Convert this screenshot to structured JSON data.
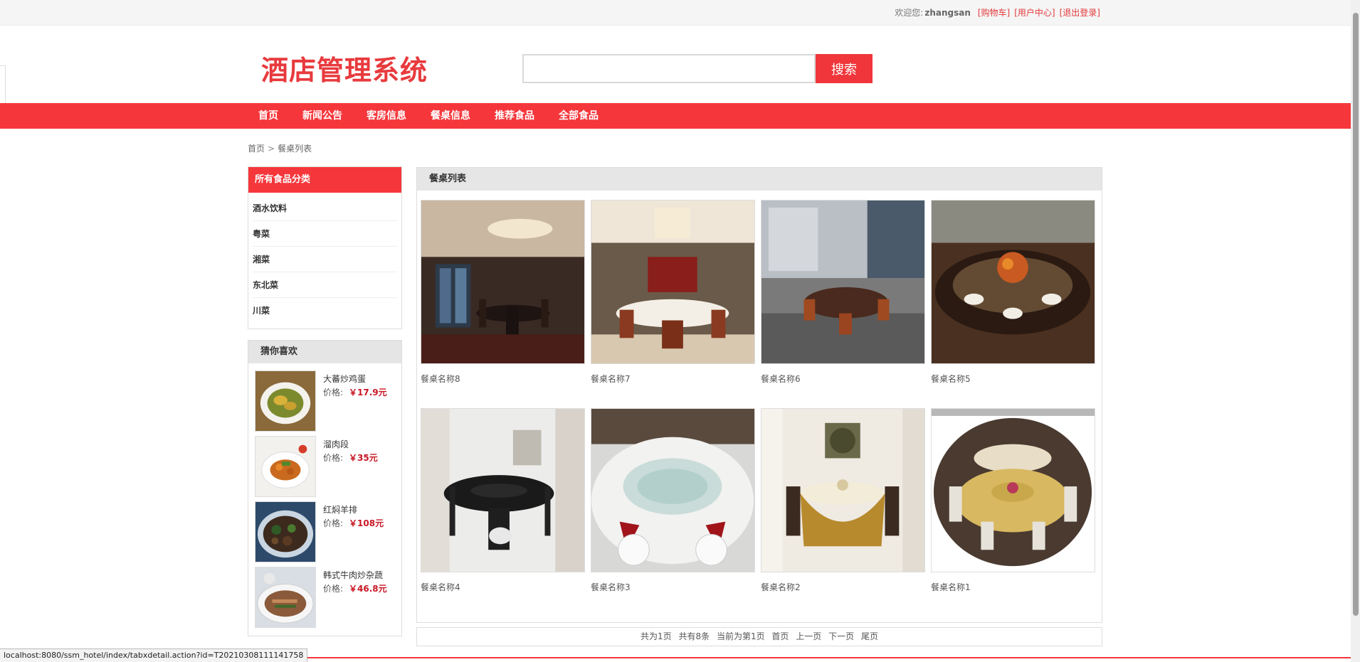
{
  "topbar": {
    "welcome": "欢迎您:",
    "username": "zhangsan",
    "links": [
      "[购物车]",
      "[用户中心]",
      "[退出登录]"
    ]
  },
  "header": {
    "logo": "酒店管理系统",
    "search_placeholder": "",
    "search_button": "搜索"
  },
  "nav": [
    "首页",
    "新闻公告",
    "客房信息",
    "餐桌信息",
    "推荐食品",
    "全部食品"
  ],
  "breadcrumb": {
    "home": "首页",
    "separator": ">",
    "current": "餐桌列表"
  },
  "categories": {
    "title": "所有食品分类",
    "items": [
      "酒水饮料",
      "粤菜",
      "湘菜",
      "东北菜",
      "川菜"
    ]
  },
  "recommend": {
    "title": "猜你喜欢",
    "price_label": "价格:",
    "items": [
      {
        "name": "大蕃炒鸡蛋",
        "price": "￥17.9元"
      },
      {
        "name": "溜肉段",
        "price": "￥35元"
      },
      {
        "name": "红焖羊排",
        "price": "￥108元"
      },
      {
        "name": "韩式牛肉炒杂蔬",
        "price": "￥46.8元"
      }
    ]
  },
  "main": {
    "title": "餐桌列表",
    "tables": [
      {
        "name": "餐桌名称8"
      },
      {
        "name": "餐桌名称7"
      },
      {
        "name": "餐桌名称6"
      },
      {
        "name": "餐桌名称5"
      },
      {
        "name": "餐桌名称4"
      },
      {
        "name": "餐桌名称3"
      },
      {
        "name": "餐桌名称2"
      },
      {
        "name": "餐桌名称1"
      }
    ]
  },
  "pager": {
    "total_pages": "共为1页",
    "total_items": "共有8条",
    "current": "当前为第1页",
    "first": "首页",
    "prev": "上一页",
    "next": "下一页",
    "last": "尾页"
  },
  "statusbar": {
    "url": "localhost:8080/ssm_hotel/index/tabxdetail.action?id=T20210308111141758"
  },
  "colors": {
    "brand_red": "#f5373b",
    "price_red": "#c81623",
    "link_red": "#e4393c"
  }
}
